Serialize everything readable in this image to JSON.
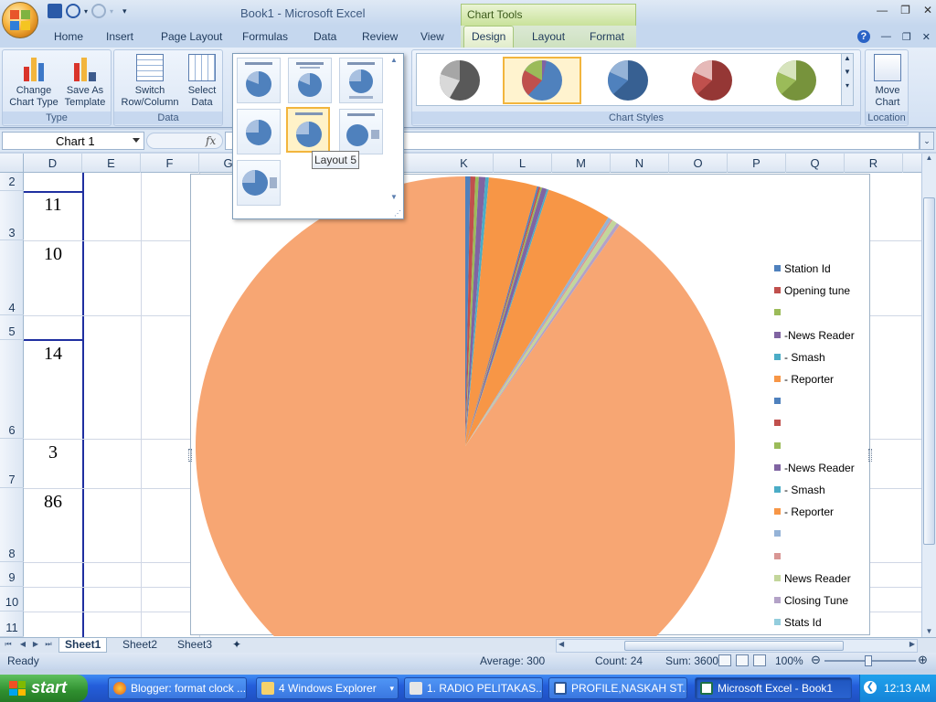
{
  "window": {
    "title": "Book1 - Microsoft Excel",
    "context_tools": "Chart Tools"
  },
  "tabs": [
    "Home",
    "Insert",
    "Page Layout",
    "Formulas",
    "Data",
    "Review",
    "View",
    "Design",
    "Layout",
    "Format"
  ],
  "active_tab": "Design",
  "ribbon": {
    "change_chart_type": "Change\nChart Type",
    "save_as_template": "Save As\nTemplate",
    "type_group": "Type",
    "switch_row_column": "Switch\nRow/Column",
    "select_data": "Select\nData",
    "data_group": "Data",
    "chart_styles_group": "Chart Styles",
    "move_chart": "Move\nChart",
    "location_group": "Location"
  },
  "gallery": {
    "tooltip": "Layout 5",
    "selected_index": 4
  },
  "formula_bar": {
    "name_box": "Chart 1",
    "fx": "fx"
  },
  "columns": [
    "D",
    "E",
    "F",
    "G",
    "K",
    "L",
    "M",
    "N",
    "O",
    "P",
    "Q",
    "R"
  ],
  "rows": [
    "2",
    "3",
    "4",
    "5",
    "6",
    "7",
    "8",
    "9",
    "10",
    "11"
  ],
  "cell_values": [
    "11",
    "10",
    "14",
    "3",
    "86"
  ],
  "chart_data": {
    "type": "pie",
    "categories": [
      "Station Id",
      "Opening tune",
      "",
      "-News Reader",
      "- Smash",
      "- Reporter",
      "",
      "",
      "",
      "-News Reader",
      "- Smash",
      "- Reporter",
      "",
      "",
      "News Reader",
      "Closing Tune",
      "Stats Id"
    ],
    "colors": [
      "#4f81bd",
      "#c0504d",
      "#9bbb59",
      "#8064a2",
      "#4bacc6",
      "#f79646",
      "#4f81bd",
      "#c0504d",
      "#9bbb59",
      "#8064a2",
      "#4bacc6",
      "#f79646",
      "#95b3d7",
      "#d99694",
      "#c3d69b",
      "#b3a2c7",
      "#93cddd"
    ],
    "values": [
      0.3,
      0.3,
      0.2,
      0.4,
      0.2,
      2.9,
      0.1,
      0.1,
      0.1,
      0.3,
      0.1,
      3.9,
      0.2,
      0.1,
      0.3,
      0.2,
      90.3
    ],
    "visible_legend": [
      "Station Id",
      "Opening tune",
      "",
      "-News Reader",
      "- Smash",
      "- Reporter",
      "",
      "",
      "",
      "-News Reader",
      "- Smash",
      "- Reporter",
      "",
      "",
      "News Reader",
      "Closing Tune",
      "Stats Id"
    ]
  },
  "sheets": [
    "Sheet1",
    "Sheet2",
    "Sheet3"
  ],
  "status": {
    "ready": "Ready",
    "average": "Average: 300",
    "count": "Count: 24",
    "sum": "Sum: 3600",
    "zoom": "100%"
  },
  "taskbar": {
    "start": "start",
    "items": [
      "Blogger: format clock ...",
      "4 Windows Explorer",
      "1. RADIO PELITAKAS...",
      "PROFILE,NASKAH ST...",
      "Microsoft Excel - Book1"
    ],
    "clock": "12:13 AM"
  }
}
